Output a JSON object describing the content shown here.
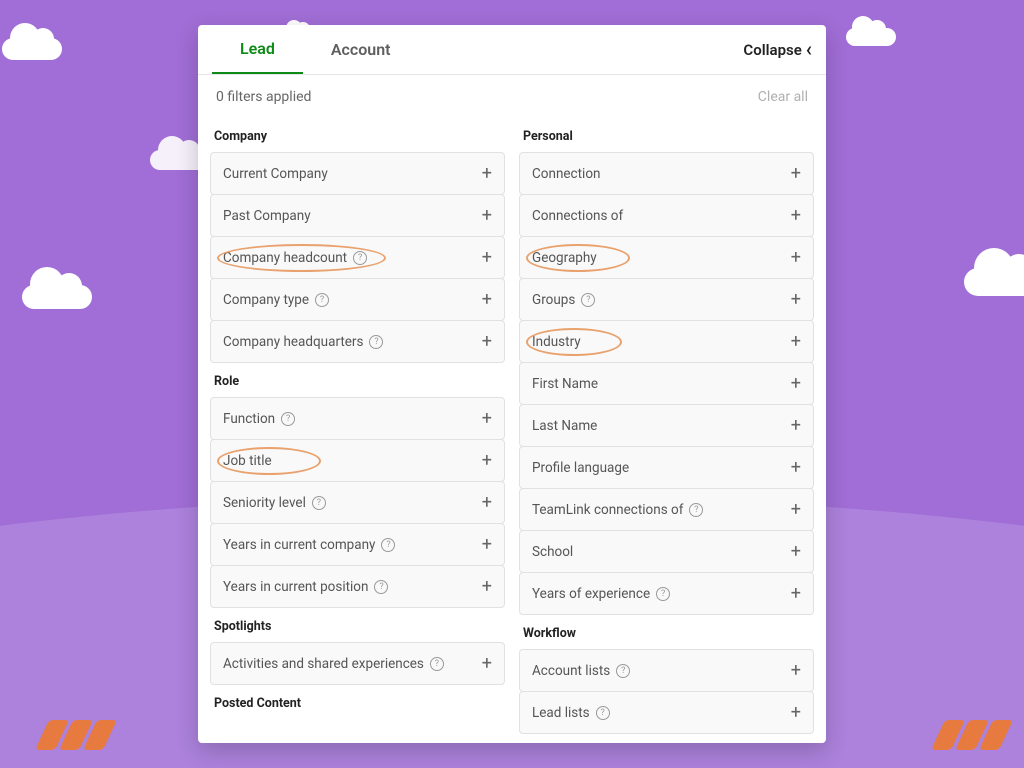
{
  "tabs": {
    "lead": "Lead",
    "account": "Account",
    "collapse": "Collapse"
  },
  "meta": {
    "filters_applied": "0 filters applied",
    "clear_all": "Clear all"
  },
  "sections": {
    "company": {
      "title": "Company",
      "items": [
        {
          "label": "Current Company",
          "info": false,
          "highlighted": false
        },
        {
          "label": "Past Company",
          "info": false,
          "highlighted": false
        },
        {
          "label": "Company headcount",
          "info": true,
          "highlighted": true
        },
        {
          "label": "Company type",
          "info": true,
          "highlighted": false
        },
        {
          "label": "Company headquarters",
          "info": true,
          "highlighted": false
        }
      ]
    },
    "role": {
      "title": "Role",
      "items": [
        {
          "label": "Function",
          "info": true,
          "highlighted": false
        },
        {
          "label": "Job title",
          "info": false,
          "highlighted": true
        },
        {
          "label": "Seniority level",
          "info": true,
          "highlighted": false
        },
        {
          "label": "Years in current company",
          "info": true,
          "highlighted": false
        },
        {
          "label": "Years in current position",
          "info": true,
          "highlighted": false
        }
      ]
    },
    "spotlights": {
      "title": "Spotlights",
      "items": [
        {
          "label": "Activities and shared experiences",
          "info": true,
          "highlighted": false
        }
      ]
    },
    "posted": {
      "title": "Posted Content"
    },
    "personal": {
      "title": "Personal",
      "items": [
        {
          "label": "Connection",
          "info": false,
          "highlighted": false
        },
        {
          "label": "Connections of",
          "info": false,
          "highlighted": false
        },
        {
          "label": "Geography",
          "info": false,
          "highlighted": true
        },
        {
          "label": "Groups",
          "info": true,
          "highlighted": false
        },
        {
          "label": "Industry",
          "info": false,
          "highlighted": true
        },
        {
          "label": "First Name",
          "info": false,
          "highlighted": false
        },
        {
          "label": "Last Name",
          "info": false,
          "highlighted": false
        },
        {
          "label": "Profile language",
          "info": false,
          "highlighted": false
        },
        {
          "label": "TeamLink connections of",
          "info": true,
          "highlighted": false
        },
        {
          "label": "School",
          "info": false,
          "highlighted": false
        },
        {
          "label": "Years of experience",
          "info": true,
          "highlighted": false
        }
      ]
    },
    "workflow": {
      "title": "Workflow",
      "items": [
        {
          "label": "Account lists",
          "info": true,
          "highlighted": false
        },
        {
          "label": "Lead lists",
          "info": true,
          "highlighted": false
        }
      ]
    }
  }
}
